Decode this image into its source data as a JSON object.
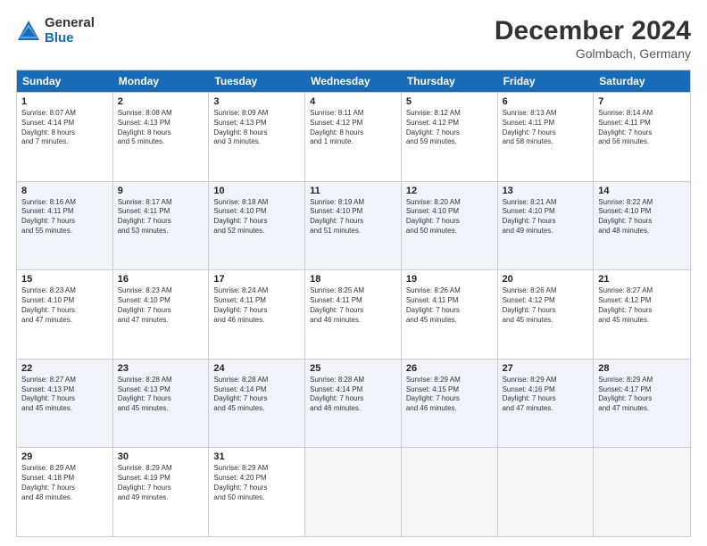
{
  "logo": {
    "general": "General",
    "blue": "Blue"
  },
  "header": {
    "month": "December 2024",
    "location": "Golmbach, Germany"
  },
  "weekdays": [
    "Sunday",
    "Monday",
    "Tuesday",
    "Wednesday",
    "Thursday",
    "Friday",
    "Saturday"
  ],
  "rows": [
    [
      {
        "day": "1",
        "info": "Sunrise: 8:07 AM\nSunset: 4:14 PM\nDaylight: 8 hours\nand 7 minutes."
      },
      {
        "day": "2",
        "info": "Sunrise: 8:08 AM\nSunset: 4:13 PM\nDaylight: 8 hours\nand 5 minutes."
      },
      {
        "day": "3",
        "info": "Sunrise: 8:09 AM\nSunset: 4:13 PM\nDaylight: 8 hours\nand 3 minutes."
      },
      {
        "day": "4",
        "info": "Sunrise: 8:11 AM\nSunset: 4:12 PM\nDaylight: 8 hours\nand 1 minute."
      },
      {
        "day": "5",
        "info": "Sunrise: 8:12 AM\nSunset: 4:12 PM\nDaylight: 7 hours\nand 59 minutes."
      },
      {
        "day": "6",
        "info": "Sunrise: 8:13 AM\nSunset: 4:11 PM\nDaylight: 7 hours\nand 58 minutes."
      },
      {
        "day": "7",
        "info": "Sunrise: 8:14 AM\nSunset: 4:11 PM\nDaylight: 7 hours\nand 56 minutes."
      }
    ],
    [
      {
        "day": "8",
        "info": "Sunrise: 8:16 AM\nSunset: 4:11 PM\nDaylight: 7 hours\nand 55 minutes."
      },
      {
        "day": "9",
        "info": "Sunrise: 8:17 AM\nSunset: 4:11 PM\nDaylight: 7 hours\nand 53 minutes."
      },
      {
        "day": "10",
        "info": "Sunrise: 8:18 AM\nSunset: 4:10 PM\nDaylight: 7 hours\nand 52 minutes."
      },
      {
        "day": "11",
        "info": "Sunrise: 8:19 AM\nSunset: 4:10 PM\nDaylight: 7 hours\nand 51 minutes."
      },
      {
        "day": "12",
        "info": "Sunrise: 8:20 AM\nSunset: 4:10 PM\nDaylight: 7 hours\nand 50 minutes."
      },
      {
        "day": "13",
        "info": "Sunrise: 8:21 AM\nSunset: 4:10 PM\nDaylight: 7 hours\nand 49 minutes."
      },
      {
        "day": "14",
        "info": "Sunrise: 8:22 AM\nSunset: 4:10 PM\nDaylight: 7 hours\nand 48 minutes."
      }
    ],
    [
      {
        "day": "15",
        "info": "Sunrise: 8:23 AM\nSunset: 4:10 PM\nDaylight: 7 hours\nand 47 minutes."
      },
      {
        "day": "16",
        "info": "Sunrise: 8:23 AM\nSunset: 4:10 PM\nDaylight: 7 hours\nand 47 minutes."
      },
      {
        "day": "17",
        "info": "Sunrise: 8:24 AM\nSunset: 4:11 PM\nDaylight: 7 hours\nand 46 minutes."
      },
      {
        "day": "18",
        "info": "Sunrise: 8:25 AM\nSunset: 4:11 PM\nDaylight: 7 hours\nand 46 minutes."
      },
      {
        "day": "19",
        "info": "Sunrise: 8:26 AM\nSunset: 4:11 PM\nDaylight: 7 hours\nand 45 minutes."
      },
      {
        "day": "20",
        "info": "Sunrise: 8:26 AM\nSunset: 4:12 PM\nDaylight: 7 hours\nand 45 minutes."
      },
      {
        "day": "21",
        "info": "Sunrise: 8:27 AM\nSunset: 4:12 PM\nDaylight: 7 hours\nand 45 minutes."
      }
    ],
    [
      {
        "day": "22",
        "info": "Sunrise: 8:27 AM\nSunset: 4:13 PM\nDaylight: 7 hours\nand 45 minutes."
      },
      {
        "day": "23",
        "info": "Sunrise: 8:28 AM\nSunset: 4:13 PM\nDaylight: 7 hours\nand 45 minutes."
      },
      {
        "day": "24",
        "info": "Sunrise: 8:28 AM\nSunset: 4:14 PM\nDaylight: 7 hours\nand 45 minutes."
      },
      {
        "day": "25",
        "info": "Sunrise: 8:28 AM\nSunset: 4:14 PM\nDaylight: 7 hours\nand 46 minutes."
      },
      {
        "day": "26",
        "info": "Sunrise: 8:29 AM\nSunset: 4:15 PM\nDaylight: 7 hours\nand 46 minutes."
      },
      {
        "day": "27",
        "info": "Sunrise: 8:29 AM\nSunset: 4:16 PM\nDaylight: 7 hours\nand 47 minutes."
      },
      {
        "day": "28",
        "info": "Sunrise: 8:29 AM\nSunset: 4:17 PM\nDaylight: 7 hours\nand 47 minutes."
      }
    ],
    [
      {
        "day": "29",
        "info": "Sunrise: 8:29 AM\nSunset: 4:18 PM\nDaylight: 7 hours\nand 48 minutes."
      },
      {
        "day": "30",
        "info": "Sunrise: 8:29 AM\nSunset: 4:19 PM\nDaylight: 7 hours\nand 49 minutes."
      },
      {
        "day": "31",
        "info": "Sunrise: 8:29 AM\nSunset: 4:20 PM\nDaylight: 7 hours\nand 50 minutes."
      },
      null,
      null,
      null,
      null
    ]
  ]
}
